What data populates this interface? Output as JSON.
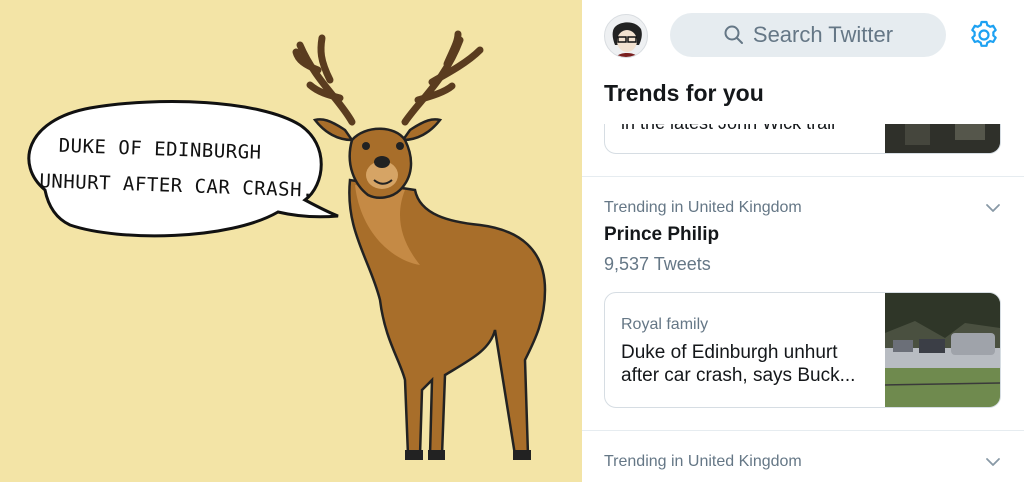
{
  "cartoon": {
    "speech_line1": "DUKE OF EDINBURGH",
    "speech_line2": "UNHURT AFTER CAR CRASH."
  },
  "twitter": {
    "search": {
      "placeholder": "Search Twitter",
      "icon": "search-icon"
    },
    "settings_icon": "gear-icon",
    "avatar_icon": "avatar",
    "heading": "Trends for you",
    "top_card": {
      "text_fragment": "in the latest John Wick trail"
    },
    "trends": [
      {
        "context": "Trending in United Kingdom",
        "name": "Prince Philip",
        "count": "9,537 Tweets"
      },
      {
        "context": "Trending in United Kingdom"
      }
    ],
    "news_card": {
      "category": "Royal family",
      "title_line1": "Duke of Edinburgh unhurt",
      "title_line2": "after car crash, says Buck..."
    },
    "colors": {
      "accent": "#1da1f2",
      "text": "#14171a",
      "secondary": "#657786",
      "search_bg": "#e6ecf0"
    }
  }
}
